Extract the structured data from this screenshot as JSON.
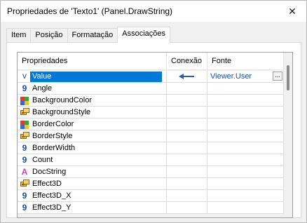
{
  "window": {
    "title": "Propriedades de 'Texto1' (Panel.DrawString)",
    "close_glyph": "✕"
  },
  "tabs": [
    {
      "label": "Item",
      "active": false
    },
    {
      "label": "Posição",
      "active": false
    },
    {
      "label": "Formatação",
      "active": false
    },
    {
      "label": "Associações",
      "active": true
    }
  ],
  "grid": {
    "headers": {
      "property": "Propriedades",
      "connection": "Conexão",
      "source": "Fonte"
    },
    "rows": [
      {
        "name": "Value",
        "icon": "variant-icon",
        "selected": true,
        "connection": "arrow-left",
        "source": "Viewer.User",
        "has_button": true,
        "button_label": "..."
      },
      {
        "name": "Angle",
        "icon": "numeric-icon"
      },
      {
        "name": "BackgroundColor",
        "icon": "color-icon"
      },
      {
        "name": "BackgroundStyle",
        "icon": "style-icon"
      },
      {
        "name": "BorderColor",
        "icon": "color-icon"
      },
      {
        "name": "BorderStyle",
        "icon": "style-icon"
      },
      {
        "name": "BorderWidth",
        "icon": "numeric-icon"
      },
      {
        "name": "Count",
        "icon": "numeric-icon"
      },
      {
        "name": "DocString",
        "icon": "string-icon"
      },
      {
        "name": "Effect3D",
        "icon": "style-icon"
      },
      {
        "name": "Effect3D_X",
        "icon": "numeric-icon"
      },
      {
        "name": "Effect3D_Y",
        "icon": "numeric-icon"
      }
    ]
  },
  "icons": {
    "numeric": "9",
    "string": "A",
    "variant": "v"
  },
  "colors": {
    "selection": "#0078d7",
    "link": "#1a4fa0",
    "arrow": "#2a5db0"
  }
}
